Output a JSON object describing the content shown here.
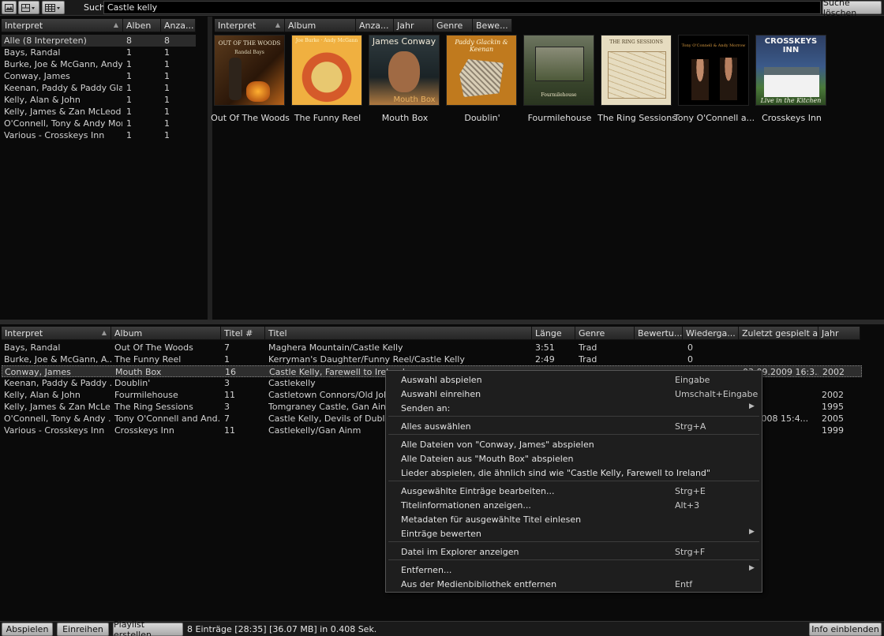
{
  "search": {
    "label": "Suche:",
    "value": "Castle kelly",
    "clear_label": "Suche löschen"
  },
  "toolbar": {
    "view_icons": [
      "image-view-icon",
      "layout-icon",
      "grid-icon"
    ]
  },
  "artists_pane": {
    "headers": [
      "Interpret",
      "Alben",
      "Anza..."
    ],
    "rows": [
      {
        "name": "Alle (8 Interpreten)",
        "albums": "8",
        "count": "8"
      },
      {
        "name": "Bays, Randal",
        "albums": "1",
        "count": "1"
      },
      {
        "name": "Burke, Joe & McGann, Andy...",
        "albums": "1",
        "count": "1"
      },
      {
        "name": "Conway, James",
        "albums": "1",
        "count": "1"
      },
      {
        "name": "Keenan, Paddy & Paddy Gla...",
        "albums": "1",
        "count": "1"
      },
      {
        "name": "Kelly, Alan & John",
        "albums": "1",
        "count": "1"
      },
      {
        "name": "Kelly, James & Zan McLeod",
        "albums": "1",
        "count": "1"
      },
      {
        "name": "O'Connell, Tony &  Andy Mor...",
        "albums": "1",
        "count": "1"
      },
      {
        "name": "Various - Crosskeys Inn",
        "albums": "1",
        "count": "1"
      }
    ]
  },
  "albums_pane": {
    "headers": [
      "Interpret",
      "Album",
      "Anza...",
      "Jahr",
      "Genre",
      "Bewe..."
    ],
    "albums": [
      {
        "title": "Out Of The Woods",
        "cover_text": "OUT OF THE WOODS",
        "cover_sub": "Randal Bays"
      },
      {
        "title": "The Funny Reel",
        "cover_text": "Joe Burke · Andy McGann",
        "cover_sub": ""
      },
      {
        "title": "Mouth Box",
        "cover_text": "James Conway",
        "cover_sub": "Mouth Box"
      },
      {
        "title": "Doublin'",
        "cover_text": "Paddy Glackin & Keenan",
        "cover_sub": ""
      },
      {
        "title": "Fourmilehouse",
        "cover_text": "Fourmilehouse",
        "cover_sub": ""
      },
      {
        "title": "The Ring Sessions",
        "cover_text": "THE RING SESSIONS",
        "cover_sub": ""
      },
      {
        "title": "Tony O'Connell a...",
        "cover_text": "Tony O'Connell & Andy Morrow",
        "cover_sub": ""
      },
      {
        "title": "Crosskeys Inn",
        "cover_text": "CROSSKEYS INN",
        "cover_sub": "Live in the Kitchen"
      }
    ]
  },
  "tracks_pane": {
    "headers": [
      "Interpret",
      "Album",
      "Titel #",
      "Titel",
      "Länge",
      "Genre",
      "Bewertu...",
      "Wiederga...",
      "Zuletzt gespielt am",
      "Jahr"
    ],
    "rows": [
      {
        "artist": "Bays, Randal",
        "album": "Out Of The Woods",
        "num": "7",
        "title": "Maghera Mountain/Castle Kelly",
        "length": "3:51",
        "genre": "Trad",
        "rating": "",
        "plays": "0",
        "last": "",
        "year": ""
      },
      {
        "artist": "Burke, Joe & McGann, A...",
        "album": "The Funny Reel",
        "num": "1",
        "title": "Kerryman's Daughter/Funny Reel/Castle Kelly",
        "length": "2:49",
        "genre": "Trad",
        "rating": "",
        "plays": "0",
        "last": "",
        "year": ""
      },
      {
        "artist": "Conway, James",
        "album": "Mouth Box",
        "num": "16",
        "title": "Castle Kelly, Farewell to Ireland",
        "length": "",
        "genre": "",
        "rating": "",
        "plays": "",
        "last": "03.09.2009 16:3...",
        "year": "2002"
      },
      {
        "artist": "Keenan, Paddy & Paddy ...",
        "album": "Doublin'",
        "num": "3",
        "title": "Castlekelly",
        "length": "",
        "genre": "",
        "rating": "",
        "plays": "",
        "last": "",
        "year": ""
      },
      {
        "artist": "Kelly, Alan & John",
        "album": "Fourmilehouse",
        "num": "11",
        "title": "Castletown Connors/Old John's",
        "length": "",
        "genre": "",
        "rating": "",
        "plays": "",
        "last": "",
        "year": "2002"
      },
      {
        "artist": "Kelly, James & Zan McLe...",
        "album": "The Ring Sessions",
        "num": "3",
        "title": "Tomgraney Castle, Gan Ainm",
        "length": "",
        "genre": "",
        "rating": "",
        "plays": "",
        "last": "",
        "year": "1995"
      },
      {
        "artist": "O'Connell, Tony &  Andy ...",
        "album": "Tony O'Connell and And...",
        "num": "7",
        "title": "Castle Kelly, Devils of Dublin, H",
        "length": "",
        "genre": "",
        "rating": "",
        "plays": "",
        "last": "12.2008 15:4...",
        "year": "2005"
      },
      {
        "artist": "Various - Crosskeys Inn",
        "album": "Crosskeys Inn",
        "num": "11",
        "title": "Castlekelly/Gan Ainm",
        "length": "",
        "genre": "",
        "rating": "",
        "plays": "",
        "last": "",
        "year": "1999"
      }
    ]
  },
  "context_menu": {
    "groups": [
      [
        {
          "label": "Auswahl abspielen",
          "shortcut": "Eingabe",
          "submenu": false
        },
        {
          "label": "Auswahl einreihen",
          "shortcut": "Umschalt+Eingabe",
          "submenu": false
        },
        {
          "label": "Senden an:",
          "shortcut": "",
          "submenu": true
        }
      ],
      [
        {
          "label": "Alles auswählen",
          "shortcut": "Strg+A",
          "submenu": false
        }
      ],
      [
        {
          "label": "Alle Dateien von \"Conway, James\" abspielen",
          "shortcut": "",
          "submenu": false
        },
        {
          "label": "Alle Dateien aus \"Mouth Box\" abspielen",
          "shortcut": "",
          "submenu": false
        },
        {
          "label": "Lieder abspielen, die ähnlich sind wie \"Castle Kelly, Farewell to Ireland\"",
          "shortcut": "",
          "submenu": false
        }
      ],
      [
        {
          "label": "Ausgewählte Einträge bearbeiten...",
          "shortcut": "Strg+E",
          "submenu": false
        },
        {
          "label": "Titelinformationen anzeigen...",
          "shortcut": "Alt+3",
          "submenu": false
        },
        {
          "label": "Metadaten für ausgewählte Titel einlesen",
          "shortcut": "",
          "submenu": false
        },
        {
          "label": "Einträge bewerten",
          "shortcut": "",
          "submenu": true
        }
      ],
      [
        {
          "label": "Datei im Explorer anzeigen",
          "shortcut": "Strg+F",
          "submenu": false
        }
      ],
      [
        {
          "label": "Entfernen...",
          "shortcut": "",
          "submenu": true
        },
        {
          "label": "Aus der Medienbibliothek entfernen",
          "shortcut": "Entf",
          "submenu": false
        }
      ]
    ]
  },
  "bottom_bar": {
    "play": "Abspielen",
    "enqueue": "Einreihen",
    "create_playlist": "Playlist erstellen",
    "status": "8 Einträge [28:35] [36.07 MB]  in 0.408 Sek.",
    "show_info": "Info einblenden"
  }
}
